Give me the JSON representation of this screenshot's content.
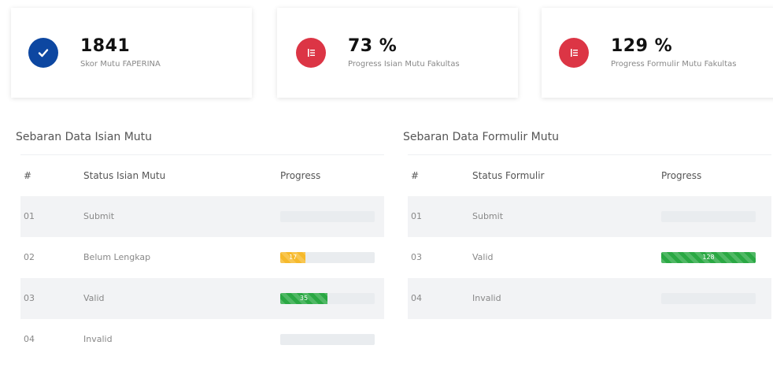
{
  "cards": [
    {
      "value": "1841",
      "label": "Skor Mutu FAPERINA",
      "icon": "check-icon",
      "color": "#0d47a1"
    },
    {
      "value": "73 %",
      "label": "Progress Isian Mutu Fakultas",
      "icon": "list-icon",
      "color": "#dc3545"
    },
    {
      "value": "129 %",
      "label": "Progress Formulir Mutu Fakultas",
      "icon": "list-icon",
      "color": "#dc3545"
    }
  ],
  "isian": {
    "title": "Sebaran Data Isian Mutu",
    "headers": {
      "no": "#",
      "status": "Status Isian Mutu",
      "progress": "Progress"
    },
    "rows": [
      {
        "no": "01",
        "status": "Submit",
        "progress_label": "",
        "progress": 0,
        "color": "#e9ecef"
      },
      {
        "no": "02",
        "status": "Belum Lengkap",
        "progress_label": "17",
        "progress": 0.27,
        "color": "#f6b92b"
      },
      {
        "no": "03",
        "status": "Valid",
        "progress_label": "35",
        "progress": 0.5,
        "color": "#2aa843"
      },
      {
        "no": "04",
        "status": "Invalid",
        "progress_label": "",
        "progress": 0,
        "color": "#e9ecef"
      }
    ]
  },
  "formulir": {
    "title": "Sebaran Data Formulir Mutu",
    "headers": {
      "no": "#",
      "status": "Status Formulir",
      "progress": "Progress"
    },
    "rows": [
      {
        "no": "01",
        "status": "Submit",
        "progress_label": "",
        "progress": 0,
        "color": "#e9ecef"
      },
      {
        "no": "03",
        "status": "Valid",
        "progress_label": "128",
        "progress": 1.0,
        "color": "#2aa843"
      },
      {
        "no": "04",
        "status": "Invalid",
        "progress_label": "",
        "progress": 0,
        "color": "#e9ecef"
      }
    ]
  }
}
